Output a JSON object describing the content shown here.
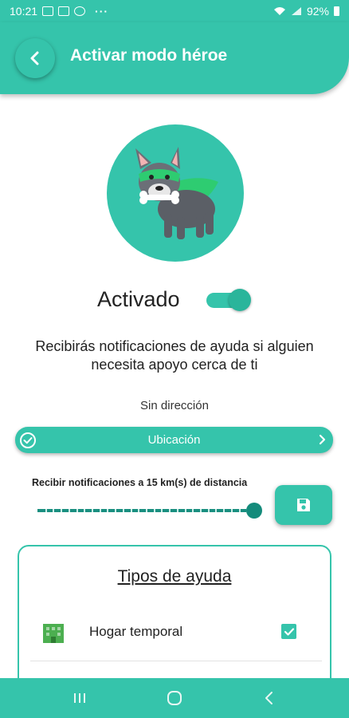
{
  "status_bar": {
    "time": "10:21",
    "dots": "···",
    "battery": "92%"
  },
  "header": {
    "title": "Activar modo héroe"
  },
  "hero": {
    "status_label": "Activado",
    "toggle_on": true,
    "description": "Recibirás notificaciones de ayuda si alguien necesita apoyo cerca de ti"
  },
  "location": {
    "address": "Sin dirección",
    "button_label": "Ubicación"
  },
  "distance": {
    "label": "Recibir notificaciones a 15 km(s) de distancia",
    "value_km": 15,
    "slider_fraction": 1.0
  },
  "help_types": {
    "title": "Tipos de ayuda",
    "items": [
      {
        "label": "Hogar temporal",
        "icon": "building-icon",
        "checked": true
      }
    ]
  },
  "colors": {
    "primary": "#35c4ab",
    "dark_accent": "#148b7b",
    "icon_green": "#4caf50"
  },
  "icons": {
    "back": "arrow-left-icon",
    "location_check": "check-circle-icon",
    "chevron": "chevron-right-icon",
    "save": "floppy-disk-icon",
    "nav_recent": "recent-apps-icon",
    "nav_home": "home-icon",
    "nav_back": "back-icon"
  }
}
